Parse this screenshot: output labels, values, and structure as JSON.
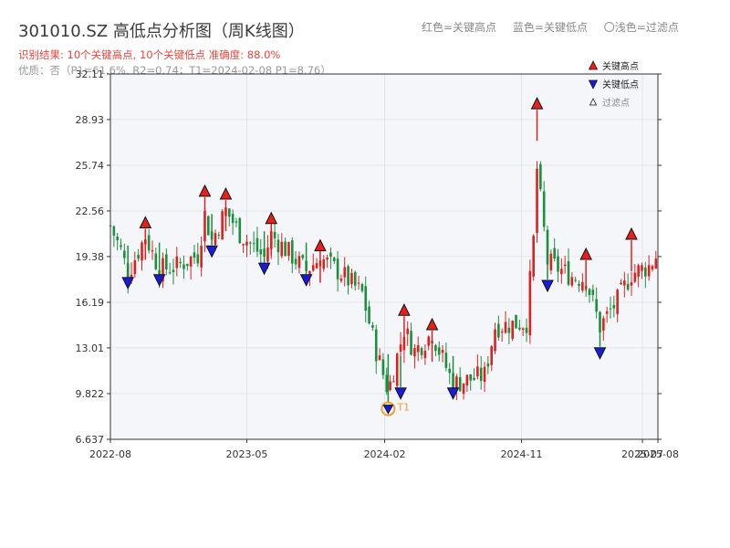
{
  "header": {
    "title": "301010.SZ 高低点分析图（周K线图）",
    "result_line": "识别结果: 10个关键高点, 10个关键低点   准确度: 88.0%",
    "quality_line": "优质：否（P1=61.6%, R2=0.74；T1=2024-02-08 P1=8.76）"
  },
  "top_legend": {
    "red_desc": "红色=关键高点",
    "blue_desc": "蓝色=关键低点",
    "light_desc": "〇浅色=过滤点"
  },
  "colors": {
    "up": "#e02020",
    "down": "#1a8f3c",
    "high_marker": "#e8201a",
    "low_marker": "#1a1adc",
    "t1_ring": "#f0a030",
    "grid": "#e2e5ea",
    "plot_bg": "#f5f6fa"
  },
  "chart_data": {
    "type": "candlestick",
    "y_ticks": [
      "6.637",
      "9.822",
      "13.01",
      "16.19",
      "19.38",
      "22.56",
      "25.74",
      "28.93",
      "32.11"
    ],
    "ylim": [
      6.637,
      32.11
    ],
    "x_ticks": [
      "2022-08",
      "2023-05",
      "2024-02",
      "2024-11",
      "2025-07",
      "2025-08"
    ],
    "xlim": [
      "2022-08-01",
      "2025-08-01"
    ],
    "legend": [
      {
        "marker": "triangle-up",
        "label": "关键高点"
      },
      {
        "marker": "triangle-down",
        "label": "关键低点"
      },
      {
        "marker": "triangle-up-outline",
        "label": "过滤点"
      }
    ],
    "key_highs": [
      {
        "date": "2022-10-10",
        "price": 21.7
      },
      {
        "date": "2023-02-06",
        "price": 23.9
      },
      {
        "date": "2023-03-20",
        "price": 23.7
      },
      {
        "date": "2023-06-19",
        "price": 22.0
      },
      {
        "date": "2023-09-25",
        "price": 20.1
      },
      {
        "date": "2024-03-11",
        "price": 15.6
      },
      {
        "date": "2024-05-06",
        "price": 14.6
      },
      {
        "date": "2024-12-02",
        "price": 30.0
      },
      {
        "date": "2025-03-10",
        "price": 19.5
      },
      {
        "date": "2025-06-09",
        "price": 20.9
      }
    ],
    "key_lows": [
      {
        "date": "2022-09-05",
        "price": 17.6
      },
      {
        "date": "2022-11-07",
        "price": 17.8
      },
      {
        "date": "2023-02-20",
        "price": 19.8
      },
      {
        "date": "2023-06-05",
        "price": 18.6
      },
      {
        "date": "2023-08-28",
        "price": 17.8
      },
      {
        "date": "2024-03-04",
        "price": 9.9
      },
      {
        "date": "2024-06-17",
        "price": 9.9
      },
      {
        "date": "2024-12-23",
        "price": 17.4
      },
      {
        "date": "2025-04-07",
        "price": 12.7
      }
    ],
    "t1": {
      "date": "2024-02-08",
      "price": 8.76,
      "label": "T1"
    },
    "anchors": [
      [
        "2022-08-01",
        21.5
      ],
      [
        "2022-08-22",
        19.8
      ],
      [
        "2022-09-05",
        18.2
      ],
      [
        "2022-10-10",
        20.8
      ],
      [
        "2022-11-07",
        18.5
      ],
      [
        "2022-12-12",
        18.7
      ],
      [
        "2023-01-23",
        19.5
      ],
      [
        "2023-02-06",
        22.3
      ],
      [
        "2023-02-20",
        20.5
      ],
      [
        "2023-03-20",
        22.6
      ],
      [
        "2023-04-17",
        21.0
      ],
      [
        "2023-06-05",
        19.3
      ],
      [
        "2023-06-19",
        20.9
      ],
      [
        "2023-08-28",
        18.4
      ],
      [
        "2023-09-25",
        19.3
      ],
      [
        "2023-11-06",
        18.2
      ],
      [
        "2023-12-18",
        16.8
      ],
      [
        "2024-01-15",
        12.8
      ],
      [
        "2024-02-08",
        10.0
      ],
      [
        "2024-03-11",
        14.3
      ],
      [
        "2024-04-01",
        12.8
      ],
      [
        "2024-05-06",
        14.0
      ],
      [
        "2024-06-17",
        10.5
      ],
      [
        "2024-08-19",
        11.1
      ],
      [
        "2024-09-09",
        14.5
      ],
      [
        "2024-11-11",
        14.8
      ],
      [
        "2024-11-25",
        20.5
      ],
      [
        "2024-12-02",
        25.5
      ],
      [
        "2024-12-23",
        19.0
      ],
      [
        "2025-02-10",
        18.0
      ],
      [
        "2025-03-10",
        17.8
      ],
      [
        "2025-04-07",
        14.5
      ],
      [
        "2025-05-12",
        16.3
      ],
      [
        "2025-06-09",
        18.2
      ],
      [
        "2025-07-14",
        18.7
      ],
      [
        "2025-08-01",
        19.6
      ]
    ]
  }
}
